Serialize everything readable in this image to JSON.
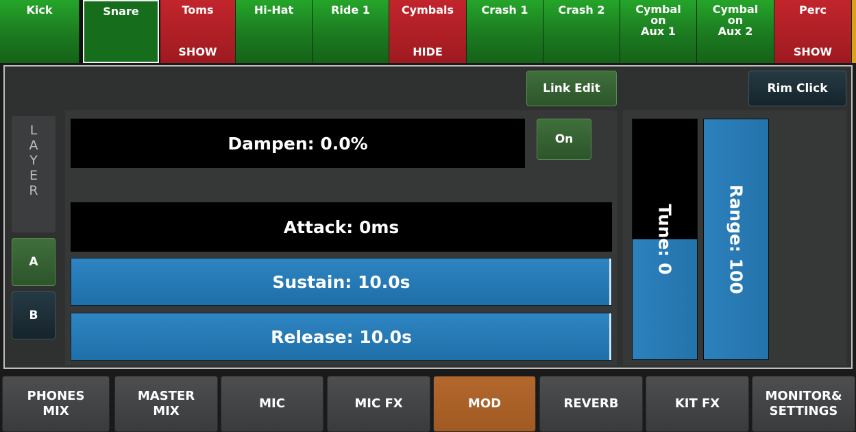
{
  "kit_tabs": [
    {
      "title": "Kick",
      "sub": "",
      "state": "green"
    },
    {
      "title": "Snare",
      "sub": "",
      "state": "selected"
    },
    {
      "title": "Toms",
      "sub": "SHOW",
      "state": "red"
    },
    {
      "title": "Hi-Hat",
      "sub": "",
      "state": "green"
    },
    {
      "title": "Ride 1",
      "sub": "",
      "state": "green"
    },
    {
      "title": "Cymbals",
      "sub": "HIDE",
      "state": "red"
    },
    {
      "title": "Crash 1",
      "sub": "",
      "state": "green"
    },
    {
      "title": "Crash 2",
      "sub": "",
      "state": "green"
    },
    {
      "title_lines": [
        "Cymbal",
        "on",
        "Aux 1"
      ],
      "state": "green"
    },
    {
      "title_lines": [
        "Cymbal",
        "on",
        "Aux 2"
      ],
      "state": "green"
    },
    {
      "title": "Perc",
      "sub": "SHOW",
      "state": "red"
    }
  ],
  "toolbar": {
    "link_edit_label": "Link Edit",
    "rim_click_label": "Rim Click"
  },
  "layer": {
    "letters": [
      "L",
      "A",
      "Y",
      "E",
      "R"
    ],
    "a_label": "A",
    "b_label": "B",
    "selected": "A"
  },
  "params": {
    "dampen": "Dampen: 0.0%",
    "dampen_toggle": "On",
    "attack": "Attack: 0ms",
    "sustain": "Sustain: 10.0s",
    "release": "Release: 10.0s",
    "tune": "Tune: 0",
    "range": "Range: 100"
  },
  "levels": {
    "tune": 0.5,
    "range": 1.0,
    "sustain": 1.0,
    "release": 1.0
  },
  "colors": {
    "tab_green": "#1b7a20",
    "tab_red": "#a91f25",
    "fader_blue": "#2a7bb6",
    "mod_active": "#a85f27"
  },
  "bottom_nav": [
    {
      "lines": [
        "PHONES",
        "MIX"
      ],
      "active": false
    },
    {
      "lines": [
        "MASTER",
        "MIX"
      ],
      "active": false
    },
    {
      "lines": [
        "MIC"
      ],
      "active": false
    },
    {
      "lines": [
        "MIC FX"
      ],
      "active": false
    },
    {
      "lines": [
        "MOD"
      ],
      "active": true
    },
    {
      "lines": [
        "REVERB"
      ],
      "active": false
    },
    {
      "lines": [
        "KIT FX"
      ],
      "active": false
    },
    {
      "lines": [
        "MONITOR&",
        "SETTINGS"
      ],
      "active": false
    }
  ]
}
